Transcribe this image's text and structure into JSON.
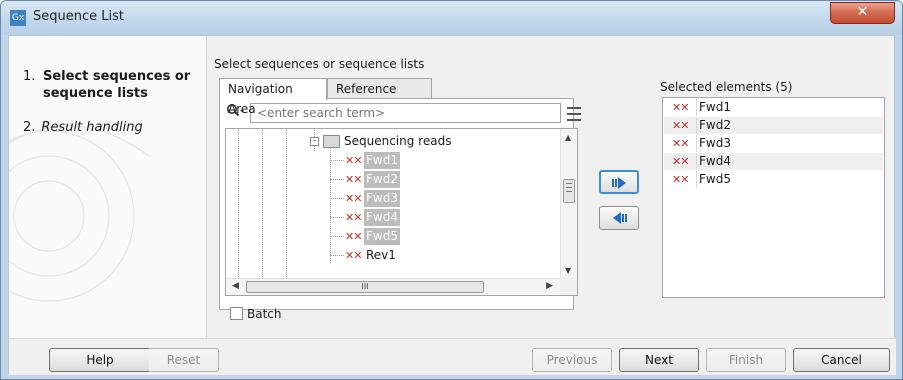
{
  "window": {
    "title": "Sequence List",
    "app_icon_text": "Gx",
    "close_glyph": "✕"
  },
  "steps": [
    {
      "number": "1.",
      "label": "Select sequences or sequence lists"
    },
    {
      "number": "2.",
      "label": "Result handling"
    }
  ],
  "main": {
    "section_label": "Select sequences or sequence lists",
    "tabs": [
      {
        "label": "Navigation Area"
      },
      {
        "label": "Reference Data"
      }
    ],
    "search": {
      "placeholder": "<enter search term>"
    },
    "tree": {
      "folder": "Sequencing reads",
      "items": [
        {
          "label": "Fwd1",
          "selected": true
        },
        {
          "label": "Fwd2",
          "selected": true
        },
        {
          "label": "Fwd3",
          "selected": true
        },
        {
          "label": "Fwd4",
          "selected": true
        },
        {
          "label": "Fwd5",
          "selected": true
        },
        {
          "label": "Rev1",
          "selected": false
        }
      ],
      "hscroll_grip": "III"
    },
    "batch_label": "Batch",
    "selected": {
      "label": "Selected elements (5)",
      "items": [
        "Fwd1",
        "Fwd2",
        "Fwd3",
        "Fwd4",
        "Fwd5"
      ]
    }
  },
  "footer": {
    "help": "Help",
    "reset": "Reset",
    "previous": "Previous",
    "next": "Next",
    "finish": "Finish",
    "cancel": "Cancel"
  },
  "icons": {
    "sequence": "sequence-icon",
    "folder": "folder-icon",
    "search": "search-icon",
    "add_arrow": "arrow-right-icon",
    "remove_arrow": "arrow-left-icon"
  },
  "colors": {
    "sequence_icon": "#c8332a",
    "selection_gray": "#bcbcbc",
    "add_button_focus": "#3a8fd9"
  }
}
